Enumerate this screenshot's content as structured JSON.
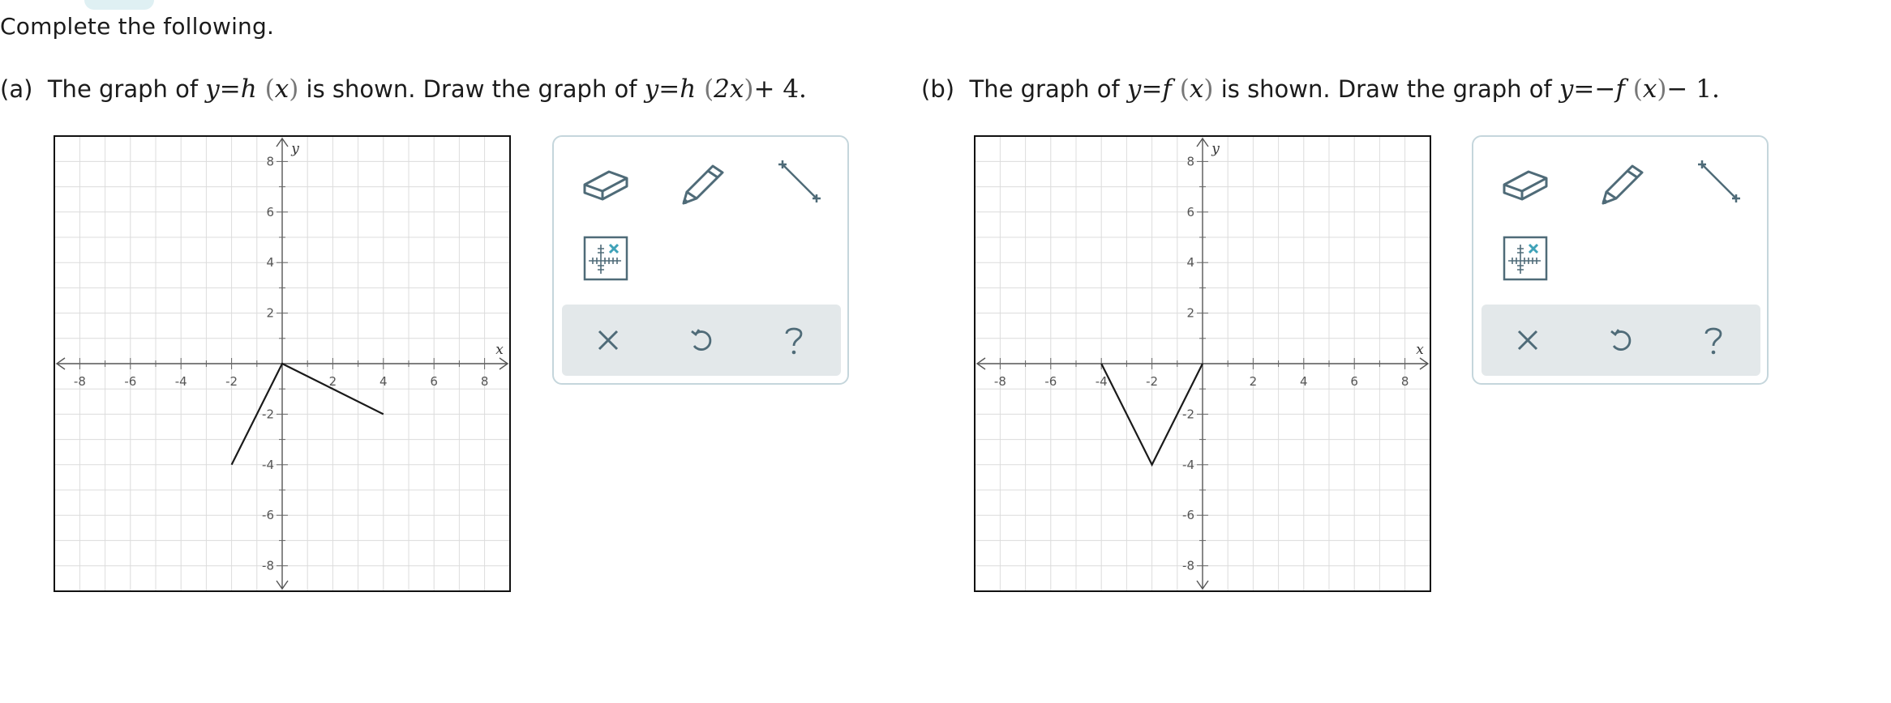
{
  "instructions": "Complete the following.",
  "part_a": {
    "letter": "(a)",
    "text_1": "The graph of",
    "given_y": "y",
    "given_eq": "=",
    "given_fn": "h",
    "given_lp": "(",
    "given_x": "x",
    "given_rp": ")",
    "text_2": "is shown. Draw the graph of",
    "target_y": "y",
    "target_eq": "=",
    "target_fn": "h",
    "target_lp": "(",
    "target_arg": "2x",
    "target_rp": ")",
    "target_rest": "+ 4.",
    "graph": {
      "x_axis_label": "x",
      "y_axis_label": "y",
      "x_ticks": [
        "-8",
        "-6",
        "-4",
        "-2",
        "2",
        "4",
        "6",
        "8"
      ],
      "y_ticks": [
        "8",
        "6",
        "4",
        "2",
        "-2",
        "-4",
        "-6",
        "-8"
      ],
      "curve": [
        [
          -2,
          -4
        ],
        [
          0,
          0
        ],
        [
          4,
          -2
        ]
      ]
    }
  },
  "part_b": {
    "letter": "(b)",
    "text_1": "The graph of",
    "given_y": "y",
    "given_eq": "=",
    "given_fn": "f",
    "given_lp": "(",
    "given_x": "x",
    "given_rp": ")",
    "text_2": "is shown. Draw the graph of",
    "target_y": "y",
    "target_eq": "=",
    "target_neg": "−",
    "target_fn": "f",
    "target_lp": "(",
    "target_arg": "x",
    "target_rp": ")",
    "target_rest": "− 1.",
    "graph": {
      "x_axis_label": "x",
      "y_axis_label": "y",
      "x_ticks": [
        "-8",
        "-6",
        "-4",
        "-2",
        "2",
        "4",
        "6",
        "8"
      ],
      "y_ticks": [
        "8",
        "6",
        "4",
        "2",
        "-2",
        "-4",
        "-6",
        "-8"
      ],
      "curve": [
        [
          -4,
          0
        ],
        [
          -2,
          -4
        ],
        [
          0,
          0
        ]
      ]
    }
  },
  "toolbox": {
    "tools": [
      "eraser-icon",
      "pencil-icon",
      "line-segment-icon",
      "point-grid-icon"
    ],
    "actions": [
      "clear-icon",
      "undo-icon",
      "help-icon"
    ],
    "colors": {
      "icon": "#4f6b78",
      "accent": "#3fa2b8",
      "bar": "#e3e8ea",
      "border": "#c5d6dc"
    }
  }
}
